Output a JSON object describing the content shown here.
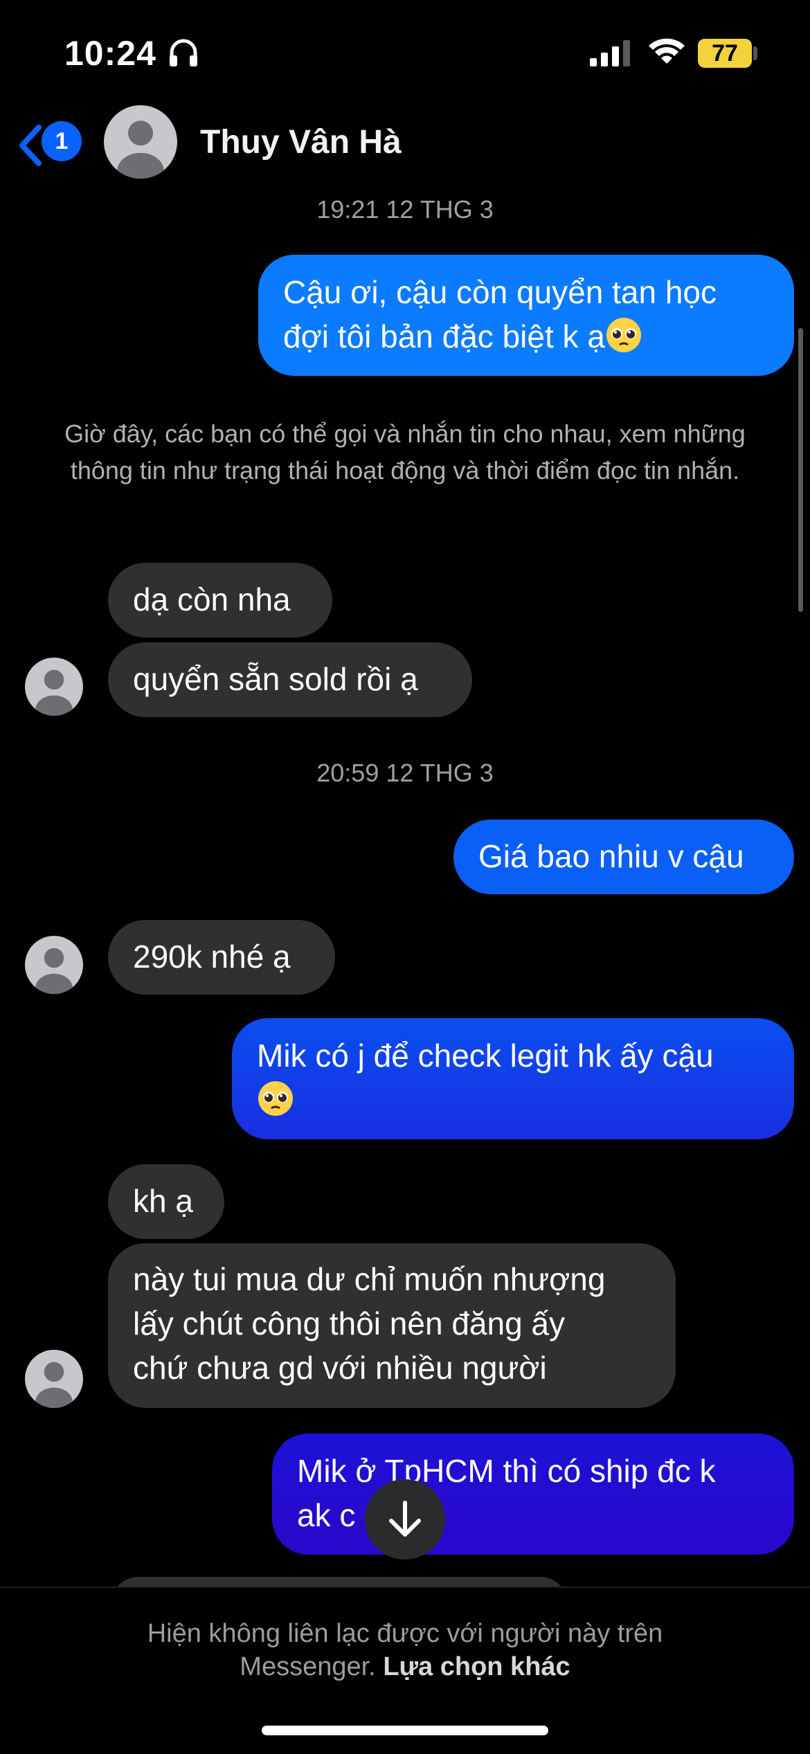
{
  "status_bar": {
    "time": "10:24",
    "battery": "77"
  },
  "header": {
    "back_badge": "1",
    "contact_name": "Thuy Vân Hà"
  },
  "timestamps": [
    "19:21 12 THG 3",
    "20:59 12 THG 3"
  ],
  "system_message": "Giờ đây, các bạn có thể gọi và nhắn tin cho nhau, xem những thông tin như trạng thái hoạt động và thời điểm đọc tin nhắn.",
  "messages": [
    {
      "sender": "me",
      "lines": [
        "Cậu ơi, cậu còn quyển tan học",
        "đợi tôi bản đặc biệt k ạ"
      ],
      "emoji": "pleading-face"
    },
    {
      "sender": "them",
      "text": "dạ còn nha"
    },
    {
      "sender": "them",
      "text": "quyển sẵn sold rồi ạ"
    },
    {
      "sender": "me",
      "text": "Giá bao nhiu v cậu"
    },
    {
      "sender": "them",
      "text": "290k nhé ạ"
    },
    {
      "sender": "me",
      "lines": [
        "Mik có j để check legit hk ấy cậu"
      ],
      "emoji": "pleading-face"
    },
    {
      "sender": "them",
      "text": "kh ạ"
    },
    {
      "sender": "them",
      "lines": [
        "này tui mua dư chỉ muốn nhượng",
        "lấy chút công thôi nên đăng ấy",
        "chứ chưa gd với nhiều người"
      ]
    },
    {
      "sender": "me",
      "lines": [
        "Mik ở TpHCM thì có ship đc k",
        "ak c"
      ]
    }
  ],
  "footer": {
    "notice": "Hiện không liên lạc được với người này trên Messenger.",
    "link": "Lựa chọn khác"
  },
  "colors": {
    "outgoing_gradient": [
      "#0b7bff",
      "#0a4ff0",
      "#1c12d8",
      "#2a07c8"
    ],
    "incoming": "#303030",
    "accent": "#0a62ff",
    "battery": "#f4d23c"
  },
  "icons": [
    "headphones-icon",
    "cellular-signal-icon",
    "wifi-icon",
    "battery-icon",
    "back-chevron-icon",
    "avatar-placeholder-icon",
    "arrow-down-icon",
    "pleading-face-emoji"
  ]
}
